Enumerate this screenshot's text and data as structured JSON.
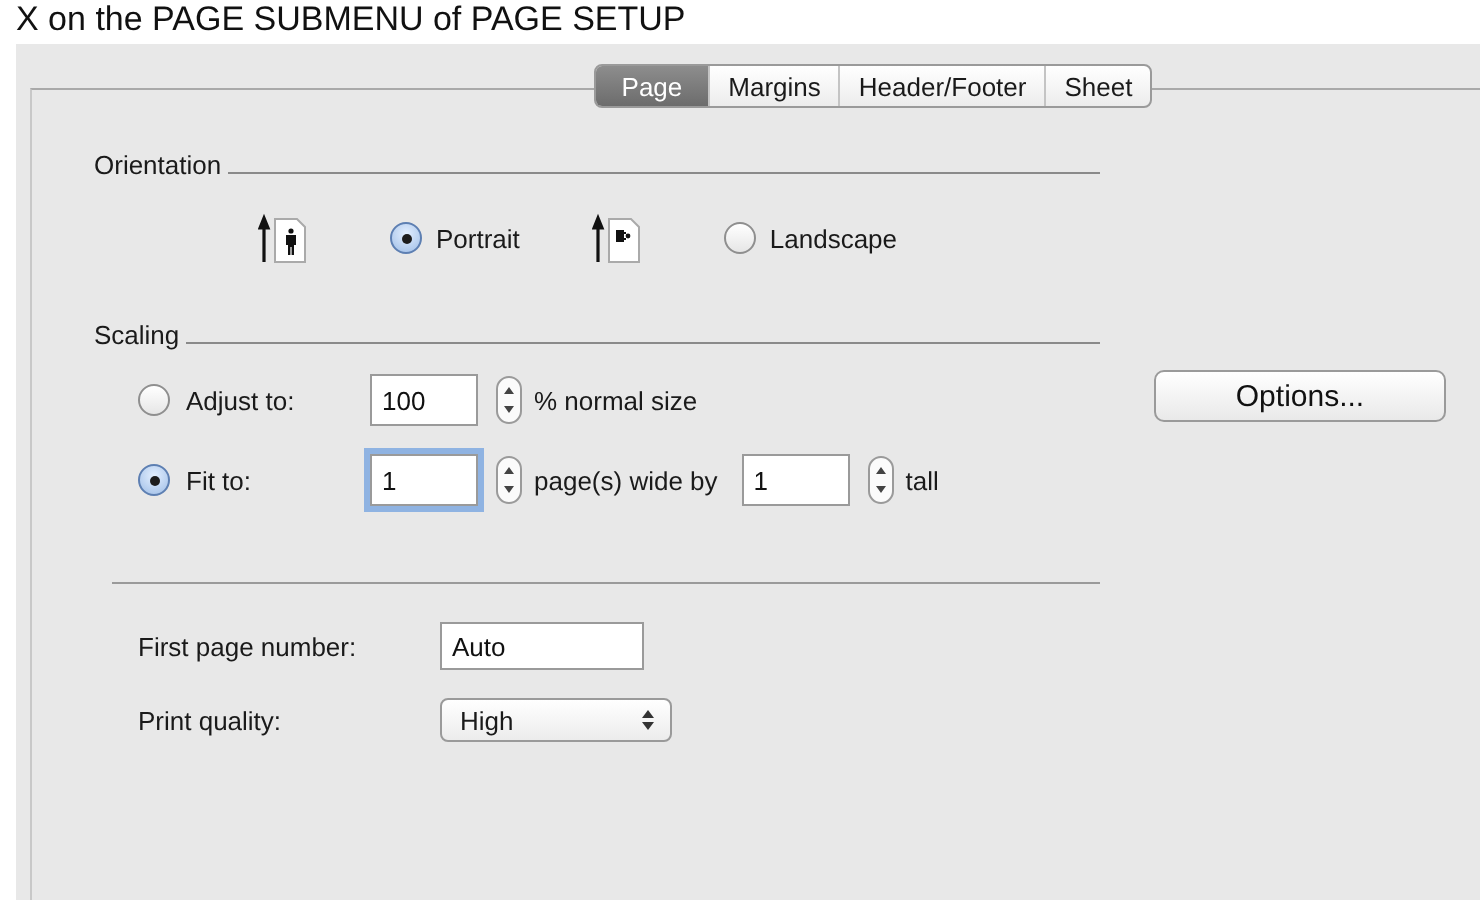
{
  "caption": "X on the PAGE SUBMENU of PAGE SETUP",
  "tabs": [
    {
      "label": "Page",
      "selected": true
    },
    {
      "label": "Margins",
      "selected": false
    },
    {
      "label": "Header/Footer",
      "selected": false
    },
    {
      "label": "Sheet",
      "selected": false
    }
  ],
  "orientation": {
    "heading": "Orientation",
    "options": [
      {
        "kind": "portrait",
        "label": "Portrait",
        "selected": true
      },
      {
        "kind": "landscape",
        "label": "Landscape",
        "selected": false
      }
    ]
  },
  "options_button": "Options...",
  "scaling": {
    "heading": "Scaling",
    "rows": [
      {
        "label": "Adjust to:",
        "selected": false,
        "focused": false,
        "value": "100",
        "after": [
          "% normal size"
        ]
      },
      {
        "label": "Fit to:",
        "selected": true,
        "focused": true,
        "value": "1",
        "after": [
          "page(s) wide by",
          "1",
          "tall"
        ]
      }
    ]
  },
  "first_page_number": {
    "label": "First page number:",
    "value": "Auto"
  },
  "print_quality": {
    "label": "Print quality:",
    "value": "High"
  }
}
